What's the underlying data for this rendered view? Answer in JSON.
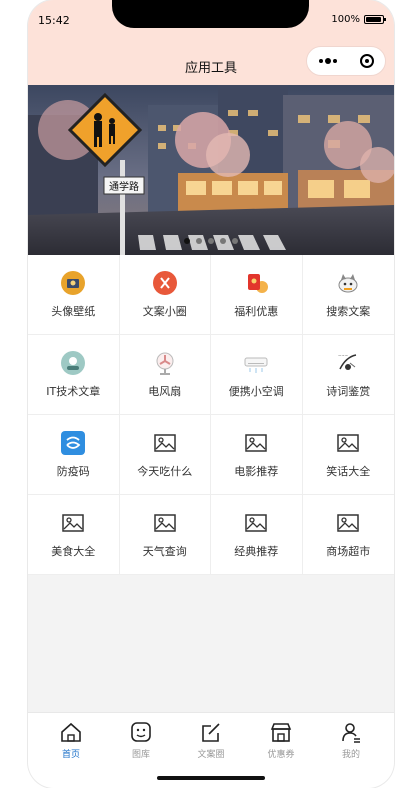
{
  "status": {
    "time": "15:42",
    "battery": "100%"
  },
  "header": {
    "title": "应用工具"
  },
  "banner": {
    "sign_text": "通学路",
    "pages": 5,
    "active_page": 0
  },
  "grid": {
    "items": [
      {
        "label": "头像壁纸",
        "icon": "avatar-wallpaper-icon"
      },
      {
        "label": "文案小圈",
        "icon": "copywriting-circle-icon"
      },
      {
        "label": "福利优惠",
        "icon": "red-packet-icon"
      },
      {
        "label": "搜索文案",
        "icon": "cat-search-icon"
      },
      {
        "label": "IT技术文章",
        "icon": "tech-article-icon"
      },
      {
        "label": "电风扇",
        "icon": "electric-fan-icon"
      },
      {
        "label": "便携小空调",
        "icon": "air-conditioner-icon"
      },
      {
        "label": "诗词鉴赏",
        "icon": "poetry-icon"
      },
      {
        "label": "防疫码",
        "icon": "health-code-icon"
      },
      {
        "label": "今天吃什么",
        "icon": "image-placeholder-icon"
      },
      {
        "label": "电影推荐",
        "icon": "image-placeholder-icon"
      },
      {
        "label": "笑话大全",
        "icon": "image-placeholder-icon"
      },
      {
        "label": "美食大全",
        "icon": "image-placeholder-icon"
      },
      {
        "label": "天气查询",
        "icon": "image-placeholder-icon"
      },
      {
        "label": "经典推荐",
        "icon": "image-placeholder-icon"
      },
      {
        "label": "商场超市",
        "icon": "image-placeholder-icon"
      }
    ]
  },
  "tabbar": {
    "items": [
      {
        "label": "首页",
        "icon": "home-icon",
        "active": true
      },
      {
        "label": "图库",
        "icon": "gallery-face-icon",
        "active": false
      },
      {
        "label": "文案圈",
        "icon": "edit-icon",
        "active": false
      },
      {
        "label": "优惠券",
        "icon": "store-icon",
        "active": false
      },
      {
        "label": "我的",
        "icon": "user-icon",
        "active": false
      }
    ]
  },
  "colors": {
    "header_bg": "#fde2d9",
    "active_tab": "#1a6fc8",
    "page_bg": "#f3f3f3"
  }
}
